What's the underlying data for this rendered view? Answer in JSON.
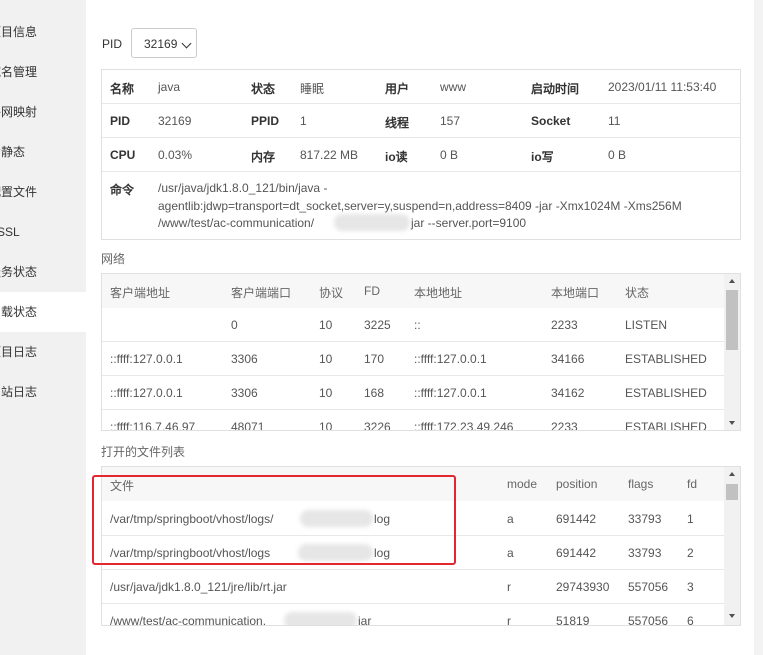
{
  "sidebar": {
    "items": [
      {
        "label": "项目信息"
      },
      {
        "label": "域名管理"
      },
      {
        "label": "外网映射"
      },
      {
        "label": "伪静态"
      },
      {
        "label": "配置文件"
      },
      {
        "label": "SSL"
      },
      {
        "label": "服务状态"
      },
      {
        "label": "负载状态"
      },
      {
        "label": "项目日志"
      },
      {
        "label": "网站日志"
      }
    ]
  },
  "pid_selector": {
    "label": "PID",
    "value": "32169"
  },
  "process_info": {
    "name_label": "名称",
    "name": "java",
    "status_label": "状态",
    "status": "睡眠",
    "user_label": "用户",
    "user": "www",
    "start_time_label": "启动时间",
    "start_time": "2023/01/11 11:53:40",
    "pid_label": "PID",
    "pid": "32169",
    "ppid_label": "PPID",
    "ppid": "1",
    "threads_label": "线程",
    "threads": "157",
    "socket_label": "Socket",
    "socket": "11",
    "cpu_label": "CPU",
    "cpu": "0.03%",
    "memory_label": "内存",
    "memory": "817.22 MB",
    "io_read_label": "io读",
    "io_read": "0 B",
    "io_write_label": "io写",
    "io_write": "0 B",
    "command_label": "命令",
    "command_line1": "/usr/java/jdk1.8.0_121/bin/java -",
    "command_line2": "agentlib:jdwp=transport=dt_socket,server=y,suspend=n,address=8409 -jar -Xmx1024M -Xms256M",
    "command_line3a": "/www/test/ac-communication/",
    "command_line3b": "jar --server.port=9100"
  },
  "network": {
    "title": "网络",
    "headers": [
      "客户端地址",
      "客户端端口",
      "协议",
      "FD",
      "本地地址",
      "本地端口",
      "状态"
    ],
    "rows": [
      [
        "",
        "0",
        "10",
        "3225",
        "::",
        "2233",
        "LISTEN"
      ],
      [
        "::ffff:127.0.0.1",
        "3306",
        "10",
        "170",
        "::ffff:127.0.0.1",
        "34166",
        "ESTABLISHED"
      ],
      [
        "::ffff:127.0.0.1",
        "3306",
        "10",
        "168",
        "::ffff:127.0.0.1",
        "34162",
        "ESTABLISHED"
      ],
      [
        "::ffff:116.7.46.97",
        "48071",
        "10",
        "3226",
        "::ffff:172.23.49.246",
        "2233",
        "ESTABLISHED"
      ]
    ]
  },
  "files": {
    "title": "打开的文件列表",
    "headers": [
      "文件",
      "mode",
      "position",
      "flags",
      "fd"
    ],
    "rows": [
      [
        "/var/tmp/springboot/vhost/logs/",
        "log",
        "a",
        "691442",
        "33793",
        "1"
      ],
      [
        "/var/tmp/springboot/vhost/logs",
        "log",
        "a",
        "691442",
        "33793",
        "2"
      ],
      [
        "/usr/java/jdk1.8.0_121/jre/lib/rt.jar",
        "",
        "r",
        "29743930",
        "557056",
        "3"
      ],
      [
        "/www/test/ac-communication.",
        "jar",
        "r",
        "51819",
        "557056",
        "6"
      ]
    ]
  }
}
